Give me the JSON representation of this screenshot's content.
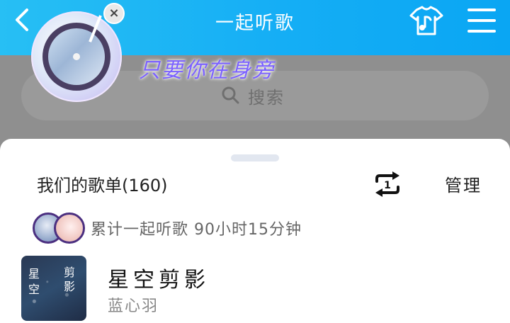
{
  "header": {
    "title": "一起听歌",
    "background_color": "#15aef5",
    "icons": {
      "back": "back-chevron-icon",
      "theme": "tshirt-music-icon",
      "menu": "menu-icon"
    }
  },
  "overlay": {
    "tagline": "只要你在身旁",
    "tagline_color": "#7b61ff",
    "search_placeholder": "搜索",
    "search_icon": "search-icon",
    "disc_icon": "vinyl-disc-icon",
    "close_symbol": "×"
  },
  "sheet": {
    "playlist_title": "我们的歌单(160)",
    "repeat_icon": "repeat-one-icon",
    "repeat_badge": "1",
    "manage_label": "管理",
    "stats_text": "累计一起听歌 90小时15分钟",
    "songs": [
      {
        "title": "星空剪影",
        "artist": "蓝心羽",
        "cover_text": "星空剪影"
      }
    ]
  }
}
